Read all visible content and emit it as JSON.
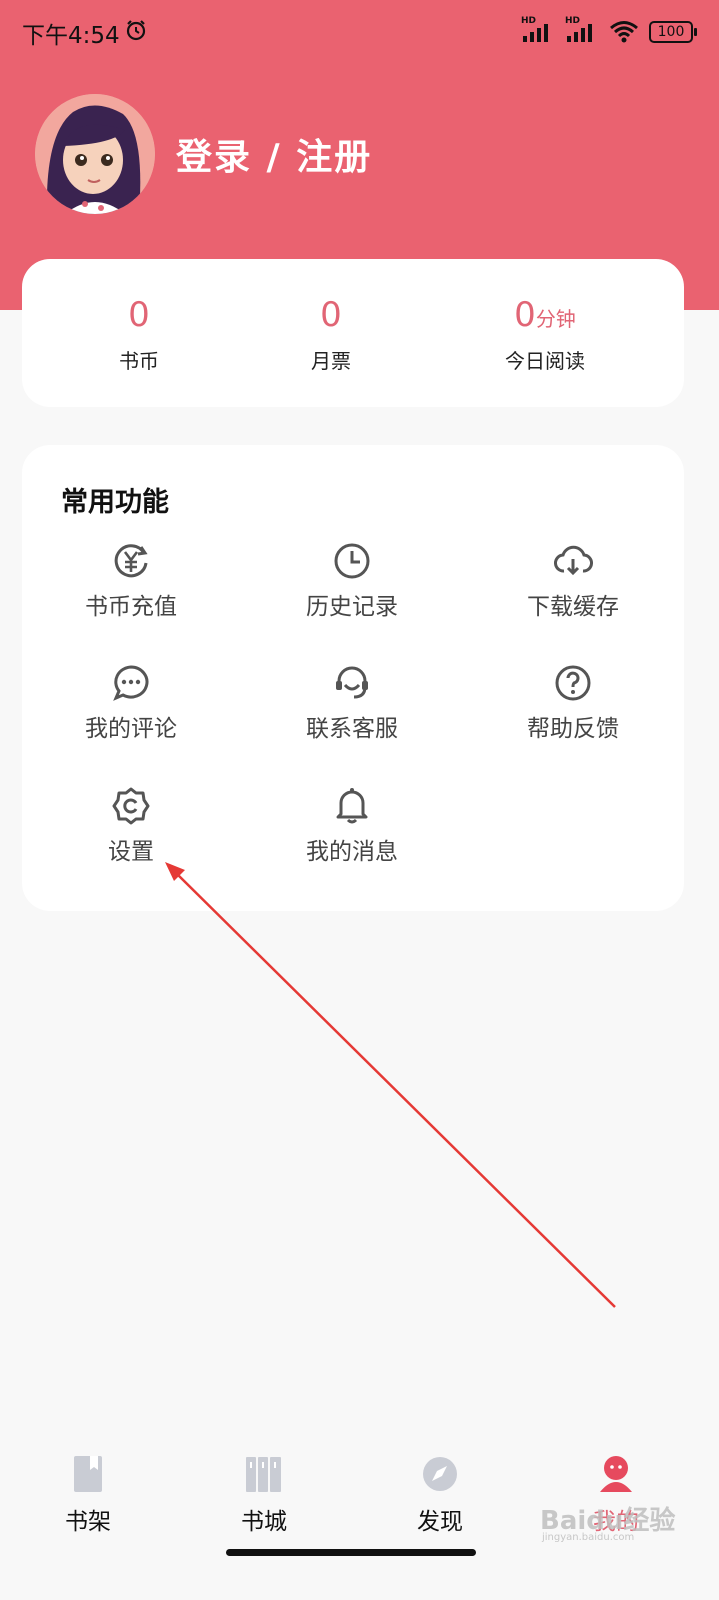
{
  "status_bar": {
    "time": "下午4:54",
    "network_1": "HD",
    "network_2": "HD",
    "battery": "100"
  },
  "profile": {
    "login_text": "登录 / 注册"
  },
  "stats": [
    {
      "value": "0",
      "unit": "",
      "label": "书币"
    },
    {
      "value": "0",
      "unit": "",
      "label": "月票"
    },
    {
      "value": "0",
      "unit": "分钟",
      "label": "今日阅读"
    }
  ],
  "functions": {
    "title": "常用功能",
    "items": [
      {
        "label": "书币充值",
        "icon": "yen-refresh-icon"
      },
      {
        "label": "历史记录",
        "icon": "clock-icon"
      },
      {
        "label": "下载缓存",
        "icon": "cloud-download-icon"
      },
      {
        "label": "我的评论",
        "icon": "chat-bubble-icon"
      },
      {
        "label": "联系客服",
        "icon": "headset-icon"
      },
      {
        "label": "帮助反馈",
        "icon": "question-icon"
      },
      {
        "label": "设置",
        "icon": "gear-icon"
      },
      {
        "label": "我的消息",
        "icon": "bell-icon"
      }
    ]
  },
  "tabbar": {
    "items": [
      {
        "label": "书架",
        "icon": "bookmark-book-icon"
      },
      {
        "label": "书城",
        "icon": "bookshelf-icon"
      },
      {
        "label": "发现",
        "icon": "compass-icon"
      },
      {
        "label": "我的",
        "icon": "person-icon"
      }
    ],
    "active_index": 3
  },
  "watermark": {
    "brand": "Baidu经验",
    "url": "jingyan.baidu.com"
  },
  "colors": {
    "header": "#ea6270",
    "accent": "#e16575",
    "annotation_arrow": "#e53935"
  }
}
